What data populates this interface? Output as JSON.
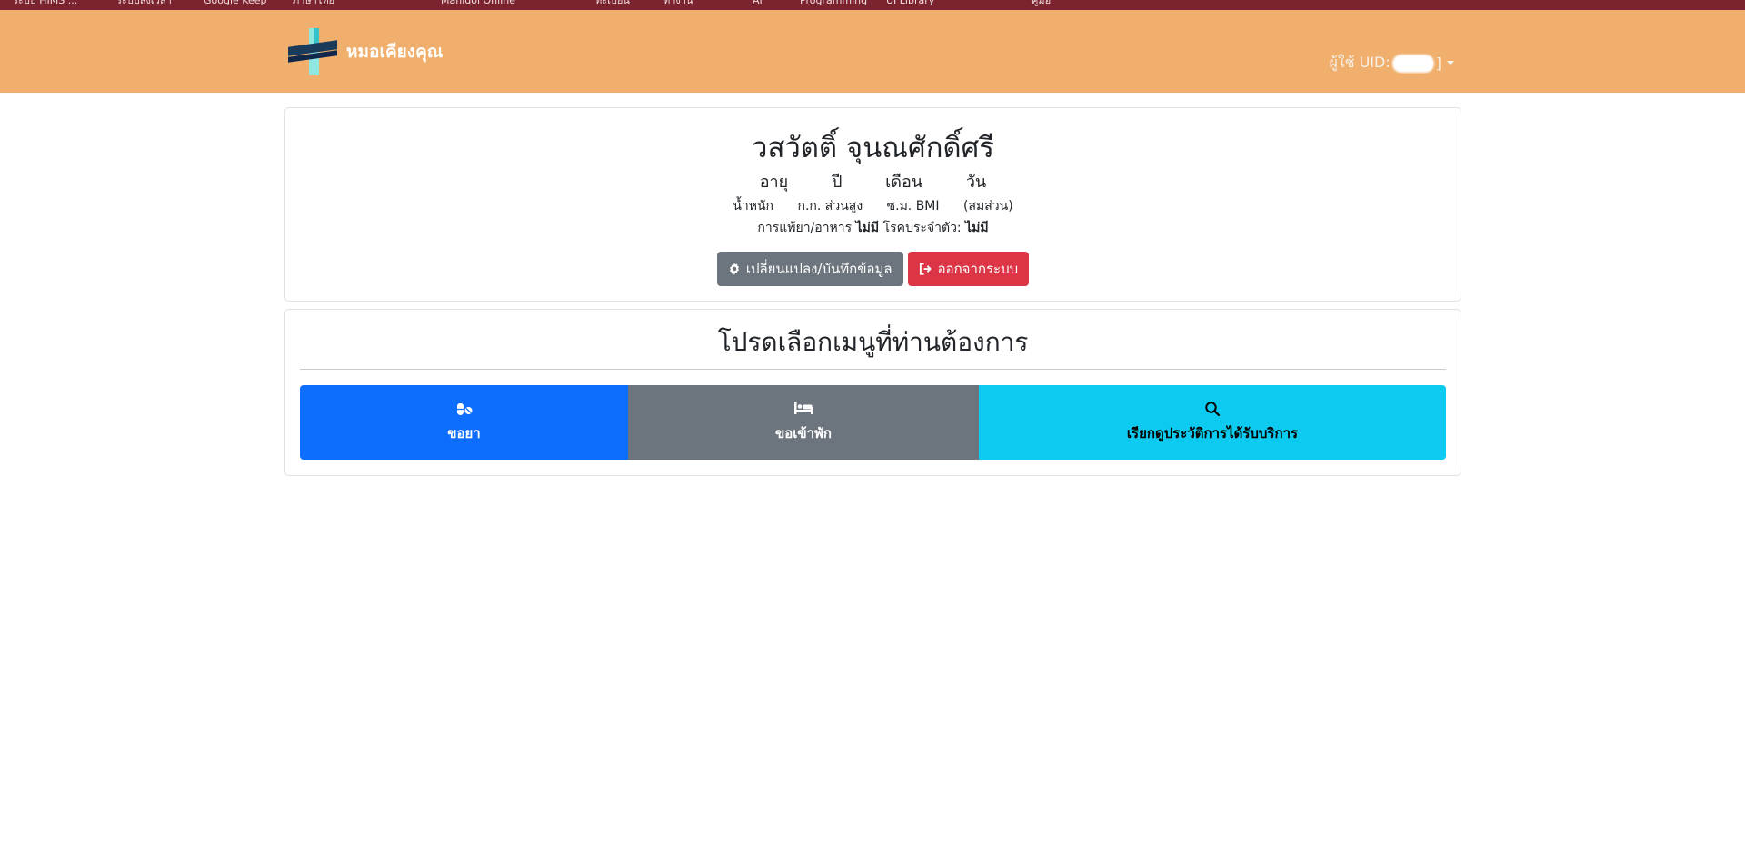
{
  "browser": {
    "bookmarks": [
      "ระบบ HIMS ...",
      "ระบบลงเวลา",
      "Google Keep",
      "ภาษาไทย",
      "Mahidol Online",
      "ทะเบียน",
      "ทำงาน",
      "AI",
      "Programming",
      "UI Library",
      "คู่มือ"
    ]
  },
  "navbar": {
    "brand": "หมอเคียงคุณ",
    "user_prefix": "ผู้ใช้ UID:",
    "user_suffix": "]"
  },
  "profile": {
    "name": "วสวัตติ์ จุนณศักดิ์ศรี",
    "age_label": "อายุ",
    "year_label": "ปี",
    "month_label": "เดือน",
    "day_label": "วัน",
    "weight_label": "น้ำหนัก",
    "weight_unit_height_label": "ก.ก. ส่วนสูง",
    "height_unit_bmi_label": "ซ.ม. BMI",
    "bmi_status": "(สมส่วน)",
    "allergy_label": "การแพ้ยา/อาหาร",
    "allergy_value": "ไม่มี",
    "disease_label": "โรคประจำตัว:",
    "disease_value": "ไม่มี",
    "edit_button": "เปลี่ยนแปลง/บันทึกข้อมูล",
    "logout_button": "ออกจากระบบ"
  },
  "menu": {
    "title": "โปรดเลือกเมนูที่ท่านต้องการ",
    "items": [
      {
        "label": "ขอยา",
        "icon": "pills-icon",
        "color": "#0d6efd"
      },
      {
        "label": "ขอเข้าพัก",
        "icon": "bed-icon",
        "color": "#6c757d"
      },
      {
        "label": "เรียกดูประวัติการได้รับบริการ",
        "icon": "search-icon",
        "color": "#0dcaf0"
      }
    ]
  },
  "colors": {
    "navbar": "#f0af6c",
    "browser_bar": "#7b2430",
    "primary": "#0d6efd",
    "secondary": "#6c757d",
    "info": "#0dcaf0",
    "danger": "#dc3545"
  }
}
